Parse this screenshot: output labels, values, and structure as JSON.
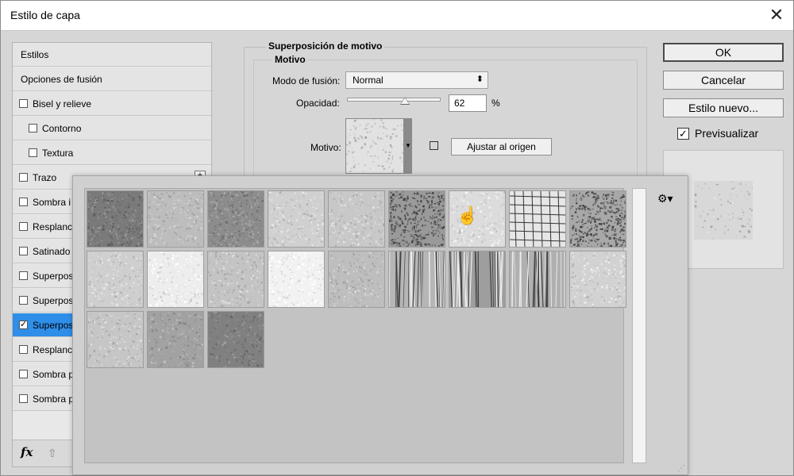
{
  "window": {
    "title": "Estilo de capa",
    "close_glyph": "✕"
  },
  "style_list": {
    "items": [
      {
        "label": "Estilos",
        "checkbox": false,
        "checked": false,
        "indent": 0,
        "selected": false
      },
      {
        "label": "Opciones de fusión",
        "checkbox": false,
        "checked": false,
        "indent": 0,
        "selected": false
      },
      {
        "label": "Bisel y relieve",
        "checkbox": true,
        "checked": false,
        "indent": 0,
        "selected": false
      },
      {
        "label": "Contorno",
        "checkbox": true,
        "checked": false,
        "indent": 1,
        "selected": false
      },
      {
        "label": "Textura",
        "checkbox": true,
        "checked": false,
        "indent": 1,
        "selected": false
      },
      {
        "label": "Trazo",
        "checkbox": true,
        "checked": false,
        "indent": 0,
        "selected": false
      },
      {
        "label": "Sombra i",
        "checkbox": true,
        "checked": false,
        "indent": 0,
        "selected": false
      },
      {
        "label": "Resplanc",
        "checkbox": true,
        "checked": false,
        "indent": 0,
        "selected": false
      },
      {
        "label": "Satinado",
        "checkbox": true,
        "checked": false,
        "indent": 0,
        "selected": false
      },
      {
        "label": "Superpos",
        "checkbox": true,
        "checked": false,
        "indent": 0,
        "selected": false
      },
      {
        "label": "Superpos",
        "checkbox": true,
        "checked": false,
        "indent": 0,
        "selected": false
      },
      {
        "label": "Superpos",
        "checkbox": true,
        "checked": true,
        "indent": 0,
        "selected": true
      },
      {
        "label": "Resplanc",
        "checkbox": true,
        "checked": false,
        "indent": 0,
        "selected": false
      },
      {
        "label": "Sombra p",
        "checkbox": true,
        "checked": false,
        "indent": 0,
        "selected": false
      },
      {
        "label": "Sombra p",
        "checkbox": true,
        "checked": false,
        "indent": 0,
        "selected": false
      }
    ],
    "plus_glyph": "+",
    "fx_label": "fx",
    "up_glyph": "⇧"
  },
  "panel": {
    "group_title": "Superposición de motivo",
    "sub_title": "Motivo",
    "blend_mode_label": "Modo de fusión:",
    "blend_mode_value": "Normal",
    "opacity_label": "Opacidad:",
    "opacity_value": "62",
    "opacity_unit": "%",
    "opacity_fraction": 0.62,
    "pattern_label": "Motivo:",
    "snap_button": "Ajustar al origen"
  },
  "buttons": {
    "ok": "OK",
    "cancel": "Cancelar",
    "new_style": "Estilo nuevo...",
    "preview_label": "Previsualizar",
    "preview_checked": true
  },
  "picker": {
    "gear_glyph": "⚙▾",
    "hand_glyph": "☝",
    "tile_count": 21
  }
}
